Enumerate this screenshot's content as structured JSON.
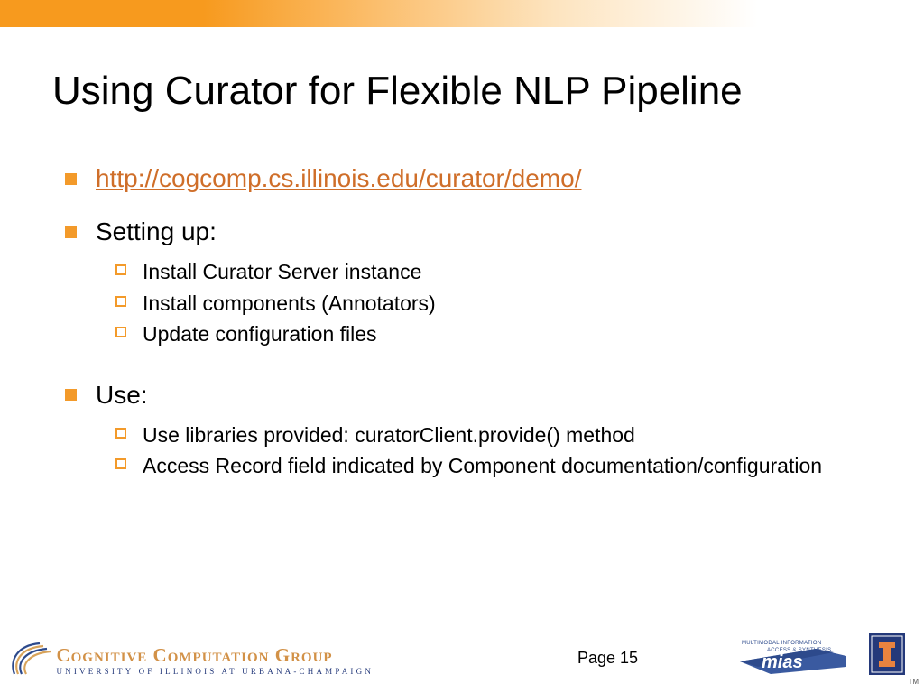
{
  "title": "Using Curator for Flexible NLP Pipeline",
  "bullets": {
    "link": "http://cogcomp.cs.illinois.edu/curator/demo/",
    "setup_heading": "Setting up:",
    "setup": [
      "Install Curator Server instance",
      "Install components (Annotators)",
      "Update configuration files"
    ],
    "use_heading": "Use:",
    "use": [
      "Use libraries provided: curatorClient.provide() method",
      "Access Record field indicated by Component documentation/configuration"
    ]
  },
  "footer": {
    "page_label": "Page 15",
    "ccg_main": "Cognitive Computation Group",
    "ccg_sub": "UNIVERSITY OF ILLINOIS AT URBANA-CHAMPAIGN",
    "mias_top": "MULTIMODAL INFORMATION",
    "mias_bottom": "ACCESS & SYNTHESIS",
    "mias_name": "mias",
    "tm": "TM"
  }
}
